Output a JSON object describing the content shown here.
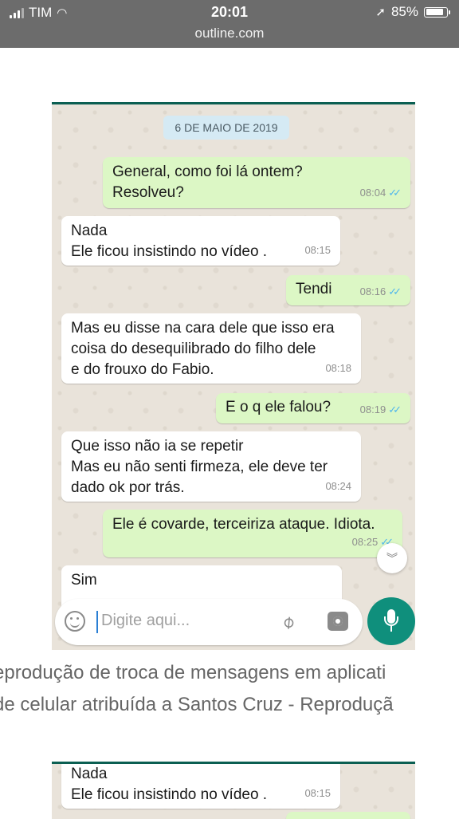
{
  "status_bar": {
    "carrier": "TIM",
    "time": "20:01",
    "battery": "85%",
    "battery_level": 0.85
  },
  "browser": {
    "url": "outline.com"
  },
  "chat": {
    "date": "6 DE MAIO DE 2019",
    "messages": [
      {
        "dir": "out",
        "text": "General, como foi lá ontem?\nResolveu?",
        "time": "08:04"
      },
      {
        "dir": "in",
        "text": "Nada\nEle ficou  insistindo no vídeo .",
        "time": "08:15"
      },
      {
        "dir": "out",
        "text": "Tendi",
        "time": "08:16"
      },
      {
        "dir": "in",
        "text": "Mas eu disse na cara dele que isso era\ncoisa do desequilibrado do filho dele\ne do frouxo do Fabio.",
        "time": "08:18"
      },
      {
        "dir": "out",
        "text": "E o q ele falou?",
        "time": "08:19"
      },
      {
        "dir": "in",
        "text": "Que isso não ia se repetir\nMas eu não senti firmeza, ele deve ter\ndado ok por trás.",
        "time": "08:24"
      },
      {
        "dir": "out",
        "text": "Ele é covarde, terceiriza ataque. Idiota.",
        "time": "08:25"
      },
      {
        "dir": "in",
        "text": "Sim",
        "time": ""
      }
    ],
    "input_placeholder": "Digite aqui...",
    "icons": [
      "emoji-icon",
      "attach-icon",
      "camera-icon",
      "mic-icon",
      "scroll-down-icon"
    ]
  },
  "caption": {
    "line1": "eprodução de troca de mensagens em aplicati",
    "line2": "de celular atribuída a Santos Cruz - Reproduçã"
  },
  "second_shot": {
    "text": "Nada\nEle ficou  insistindo no vídeo .",
    "time": "08:15"
  }
}
